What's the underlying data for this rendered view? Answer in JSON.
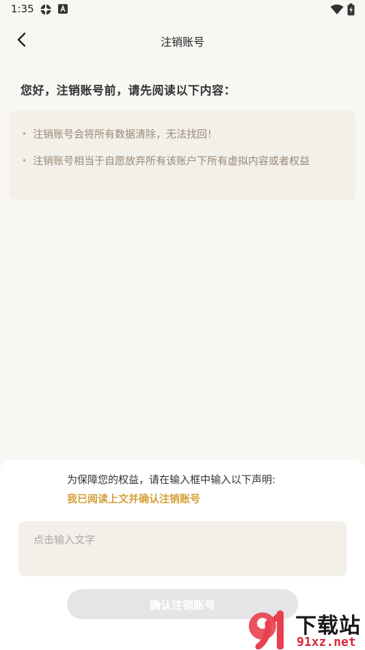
{
  "status_bar": {
    "time": "1:35",
    "left_icons": [
      "network-icon",
      "app-notification-icon"
    ],
    "right_icons": [
      "wifi-icon",
      "battery-icon"
    ]
  },
  "nav": {
    "back_icon": "chevron-left-icon",
    "title": "注销账号"
  },
  "intro": "您好，注销账号前，请先阅读以下内容：",
  "notices": [
    "注销账号会将所有数据清除，无法找回！",
    "注销账号相当于自愿放弃所有该账户下所有虚拟内容或者权益"
  ],
  "bottom_sheet": {
    "hint": "为保障您的权益，请在输入框中输入以下声明:",
    "statement": "我已阅读上文并确认注销账号",
    "input_placeholder": "点击输入文字",
    "input_value": "",
    "confirm_label": "确认注销账号"
  },
  "watermark": {
    "text": "下载站",
    "url": "91xz.net"
  },
  "colors": {
    "background": "#f9f7f4",
    "card": "#f3efe9",
    "accent": "#d4a037",
    "notice_text": "#9a8a76",
    "button_disabled": "#e5e5e5"
  }
}
